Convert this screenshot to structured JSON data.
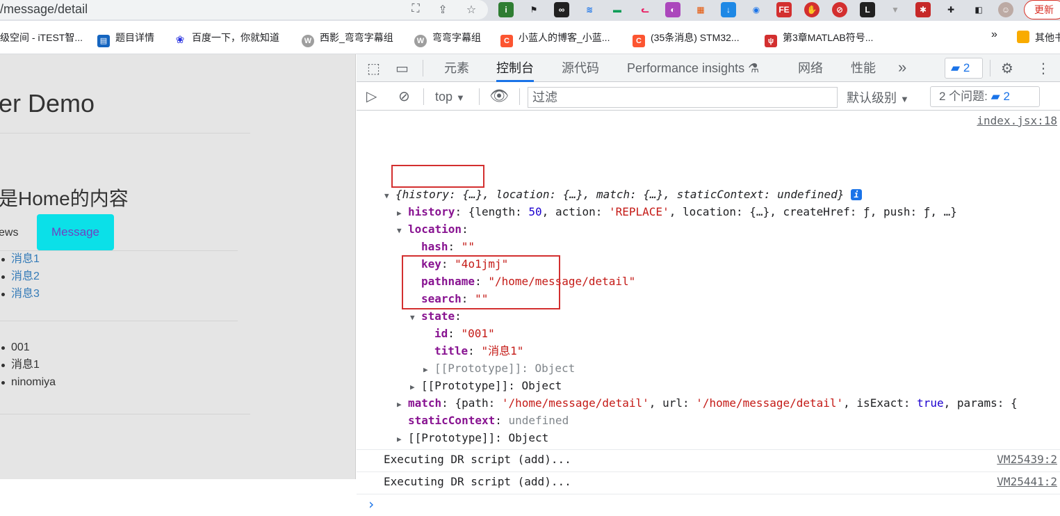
{
  "browser": {
    "url": "/message/detail",
    "update_label": "更新"
  },
  "bookmarks": [
    {
      "label": "级空间 - iTEST智...",
      "color": "#ffffff"
    },
    {
      "label": "题目详情",
      "color": "#1565c0"
    },
    {
      "label": "百度一下，你就知道",
      "color": "#2932e1"
    },
    {
      "label": "西影_弯弯字幕组",
      "color": "#9e9e9e"
    },
    {
      "label": "弯弯字幕组",
      "color": "#9e9e9e"
    },
    {
      "label": "小蓝人的博客_小蓝...",
      "color": "#fc5531"
    },
    {
      "label": "(35条消息) STM32...",
      "color": "#fc5531"
    },
    {
      "label": "第3章MATLAB符号...",
      "color": "#d32f2f"
    },
    {
      "label": "»",
      "color": "#ffffff"
    },
    {
      "label": "其他书",
      "color": "#f9ab00"
    }
  ],
  "page": {
    "title_partial": "er Demo",
    "home_heading": "是Home的内容",
    "news_tab": "ews",
    "message_tab": "Message",
    "messages": [
      "消息1",
      "消息2",
      "消息3"
    ],
    "detail": [
      "001",
      "消息1",
      "ninomiya"
    ]
  },
  "devtools": {
    "tabs": [
      "元素",
      "控制台",
      "源代码",
      "Performance insights",
      "网络",
      "性能"
    ],
    "active_tab": "控制台",
    "issues_count": "2",
    "context": "top",
    "filter_placeholder": "过滤",
    "level": "默认级别",
    "issues_label": "2 个问题:",
    "issues_count2": "2",
    "log_source": "index.jsx:18",
    "object_summary": "{history: {…}, location: {…}, match: {…}, staticContext: undefined}",
    "history_line": {
      "key": "history",
      "value_prefix": "{length: ",
      "length": "50",
      "action_label": ", action: ",
      "action": "'REPLACE'",
      "rest": ", location: {…}, createHref: ƒ, push: ƒ, …}"
    },
    "location": {
      "key": "location",
      "hash_key": "hash",
      "hash": "\"\"",
      "key_key": "key",
      "key_val": "\"4o1jmj\"",
      "pathname_key": "pathname",
      "pathname": "\"/home/message/detail\"",
      "search_key": "search",
      "search": "\"\"",
      "state_key": "state",
      "id_key": "id",
      "id": "\"001\"",
      "title_key": "title",
      "title": "\"消息1\"",
      "proto_inner": "[[Prototype]]: Object",
      "proto_outer": "[[Prototype]]: Object"
    },
    "match_line": {
      "key": "match",
      "p1": "{path: ",
      "path": "'/home/message/detail'",
      "p2": ", url: ",
      "url": "'/home/message/detail'",
      "p3": ", isExact: ",
      "exact": "true",
      "p4": ", params: {"
    },
    "static_key": "staticContext",
    "static_val": "undefined",
    "proto_root": "[[Prototype]]: Object",
    "logs": [
      {
        "text": "Executing DR script (add)...",
        "src": "VM25439:2"
      },
      {
        "text": "Executing DR script (add)...",
        "src": "VM25441:2"
      }
    ],
    "prompt": "›"
  }
}
